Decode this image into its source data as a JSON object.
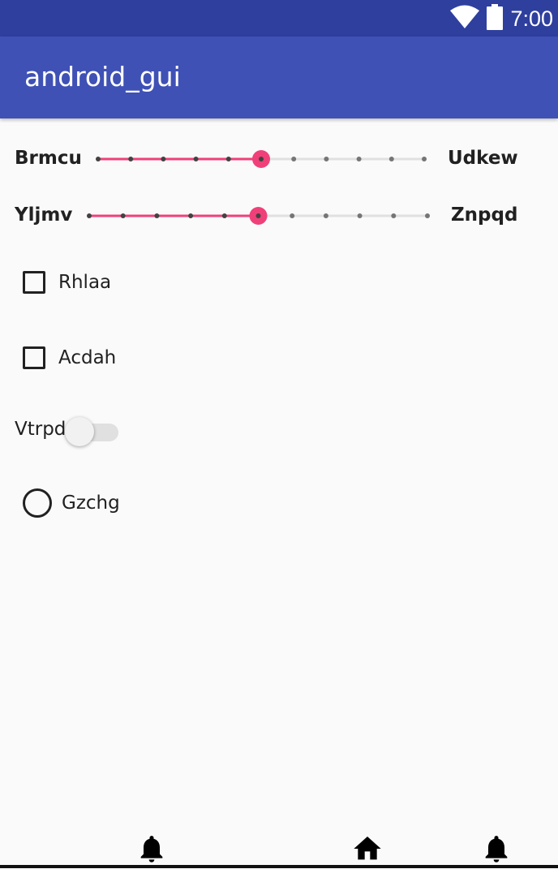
{
  "status_bar": {
    "time": "7:00",
    "icons": [
      "wifi-icon",
      "battery-icon"
    ]
  },
  "app_bar": {
    "title": "android_gui"
  },
  "sliders": [
    {
      "left_label": "Brmcu",
      "right_label": "Udkew",
      "value": 5,
      "max": 10
    },
    {
      "left_label": "Yljmv",
      "right_label": "Znpqd",
      "value": 5,
      "max": 10
    }
  ],
  "checkboxes": [
    {
      "label": "Rhlaa",
      "checked": false
    },
    {
      "label": "Acdah",
      "checked": false
    }
  ],
  "switch": {
    "label": "Vtrpd",
    "on": false
  },
  "radio": {
    "label": "Gzchg",
    "selected": false
  },
  "bottom_nav": {
    "icons": [
      "bell-icon",
      "home-icon",
      "bell-icon"
    ]
  },
  "colors": {
    "status_bar": "#2f3f9e",
    "app_bar": "#3f51b5",
    "accent": "#f0407a",
    "background": "#fafafa"
  }
}
